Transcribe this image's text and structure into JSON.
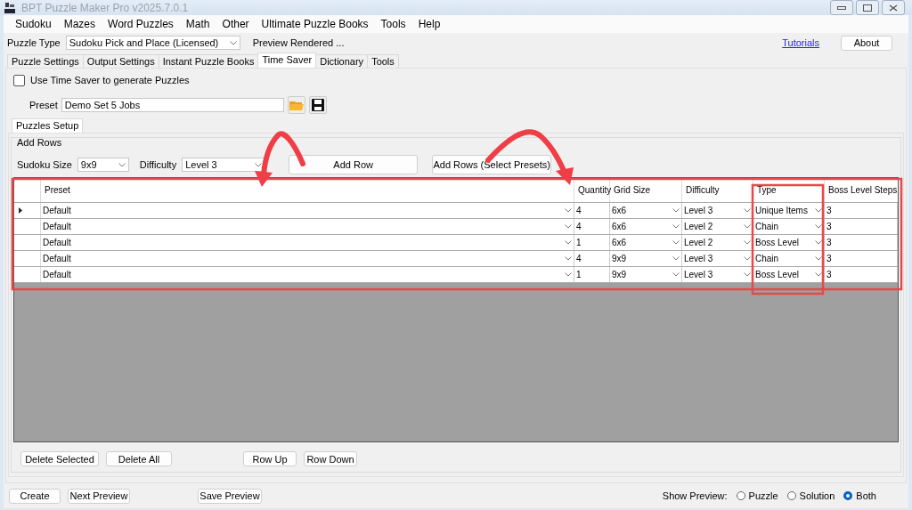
{
  "window": {
    "title": "BPT Puzzle Maker Pro v2025.7.0.1"
  },
  "menu": [
    "Sudoku",
    "Mazes",
    "Word Puzzles",
    "Math",
    "Other",
    "Ultimate Puzzle Books",
    "Tools",
    "Help"
  ],
  "puzzle_type": {
    "label": "Puzzle Type",
    "value": "Sudoku Pick and Place (Licensed)"
  },
  "preview_status": "Preview Rendered ...",
  "tutorials_link": "Tutorials",
  "about_button": "About",
  "tabs": [
    {
      "label": "Puzzle Settings",
      "selected": false
    },
    {
      "label": "Output Settings",
      "selected": false
    },
    {
      "label": "Instant Puzzle Books",
      "selected": false
    },
    {
      "label": "Time Saver",
      "selected": true
    },
    {
      "label": "Dictionary",
      "selected": false
    },
    {
      "label": "Tools",
      "selected": false
    }
  ],
  "use_time_saver": {
    "label": "Use Time Saver to generate Puzzles",
    "checked": false
  },
  "preset": {
    "label": "Preset",
    "value": "Demo Set 5 Jobs"
  },
  "inner_tabs": [
    {
      "label": "Puzzles Setup",
      "selected": true
    }
  ],
  "add_rows": {
    "title": "Add Rows",
    "size_label": "Sudoku Size",
    "size_value": "9x9",
    "difficulty_label": "Difficulty",
    "difficulty_value": "Level 3",
    "buttons": [
      "Add Row",
      "Add Rows (Select Presets)"
    ]
  },
  "table": {
    "columns": [
      "Preset",
      "Quantity",
      "Grid Size",
      "Difficulty",
      "Type",
      "Boss Level Steps"
    ],
    "rows": [
      {
        "current": true,
        "preset": "Default",
        "quantity": "4",
        "grid_size": "6x6",
        "difficulty": "Level 3",
        "type": "Unique Items",
        "boss_level_steps": "3"
      },
      {
        "current": false,
        "preset": "Default",
        "quantity": "4",
        "grid_size": "6x6",
        "difficulty": "Level 2",
        "type": "Chain",
        "boss_level_steps": "3"
      },
      {
        "current": false,
        "preset": "Default",
        "quantity": "1",
        "grid_size": "6x6",
        "difficulty": "Level 2",
        "type": "Boss Level",
        "boss_level_steps": "3"
      },
      {
        "current": false,
        "preset": "Default",
        "quantity": "4",
        "grid_size": "9x9",
        "difficulty": "Level 3",
        "type": "Chain",
        "boss_level_steps": "3"
      },
      {
        "current": false,
        "preset": "Default",
        "quantity": "1",
        "grid_size": "9x9",
        "difficulty": "Level 3",
        "type": "Boss Level",
        "boss_level_steps": "3"
      }
    ]
  },
  "grid_buttons": [
    "Delete Selected",
    "Delete All",
    "Row Up",
    "Row Down"
  ],
  "bottom_buttons": [
    "Create",
    "Next Preview",
    "Save Preview"
  ],
  "show_preview": {
    "label": "Show Preview:",
    "options": [
      {
        "label": "Puzzle",
        "selected": false
      },
      {
        "label": "Solution",
        "selected": false
      },
      {
        "label": "Both",
        "selected": true
      }
    ]
  }
}
